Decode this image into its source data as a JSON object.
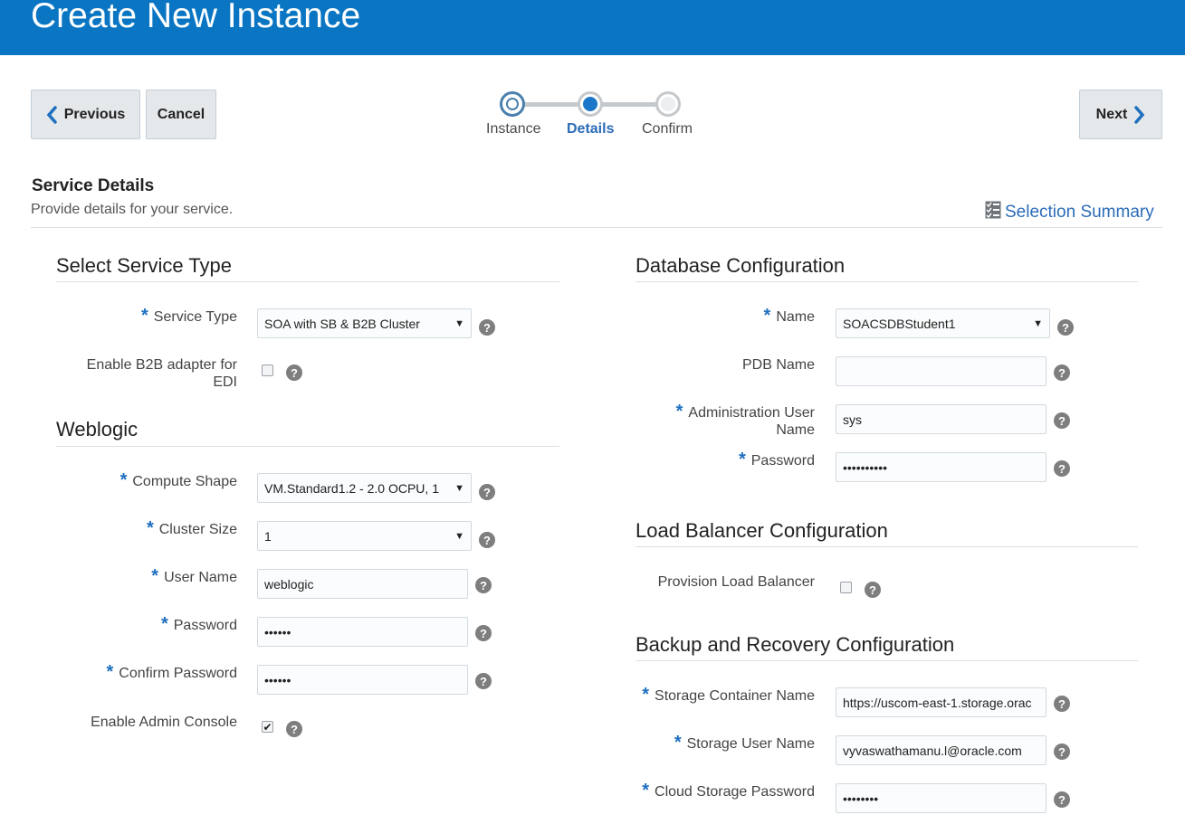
{
  "page": {
    "title": "Create New Instance"
  },
  "nav": {
    "previous": "Previous",
    "cancel": "Cancel",
    "next": "Next"
  },
  "train": {
    "steps": [
      {
        "label": "Instance",
        "state": "visited"
      },
      {
        "label": "Details",
        "state": "current"
      },
      {
        "label": "Confirm",
        "state": "unvisited"
      }
    ]
  },
  "service_details": {
    "title": "Service Details",
    "subtitle": "Provide details for your service.",
    "selection_summary": "Selection Summary"
  },
  "select_service_type": {
    "title": "Select Service Type",
    "service_type_label": "Service Type",
    "service_type_value": "SOA with SB & B2B Cluster",
    "b2b_label": "Enable B2B adapter for EDI",
    "b2b_checked": false
  },
  "weblogic": {
    "title": "Weblogic",
    "compute_shape_label": "Compute Shape",
    "compute_shape_value": "VM.Standard1.2 - 2.0 OCPU, 1",
    "cluster_size_label": "Cluster Size",
    "cluster_size_value": "1",
    "user_name_label": "User Name",
    "user_name_value": "weblogic",
    "password_label": "Password",
    "password_value": "••••••",
    "confirm_password_label": "Confirm Password",
    "confirm_password_value": "••••••",
    "admin_console_label": "Enable Admin Console",
    "admin_console_checked": true
  },
  "database": {
    "title": "Database Configuration",
    "name_label": "Name",
    "name_value": "SOACSDBStudent1",
    "pdb_label": "PDB Name",
    "pdb_value": "",
    "admin_user_label": "Administration User Name",
    "admin_user_value": "sys",
    "password_label": "Password",
    "password_value": "••••••••••"
  },
  "load_balancer": {
    "title": "Load Balancer Configuration",
    "provision_label": "Provision Load Balancer",
    "provision_checked": false
  },
  "backup": {
    "title": "Backup and Recovery Configuration",
    "container_label": "Storage Container Name",
    "container_value": "https://uscom-east-1.storage.orac",
    "storage_user_label": "Storage User Name",
    "storage_user_value": "vyvaswathamanu.l@oracle.com",
    "cloud_password_label": "Cloud Storage Password",
    "cloud_password_value": "••••••••"
  },
  "icons": {
    "help": "help-icon",
    "summary": "checklist-icon",
    "prev": "chevron-left-icon",
    "next": "chevron-right-icon"
  },
  "colors": {
    "header": "#0a76c3",
    "accent": "#1e6fbf",
    "link": "#2b6cb8"
  }
}
